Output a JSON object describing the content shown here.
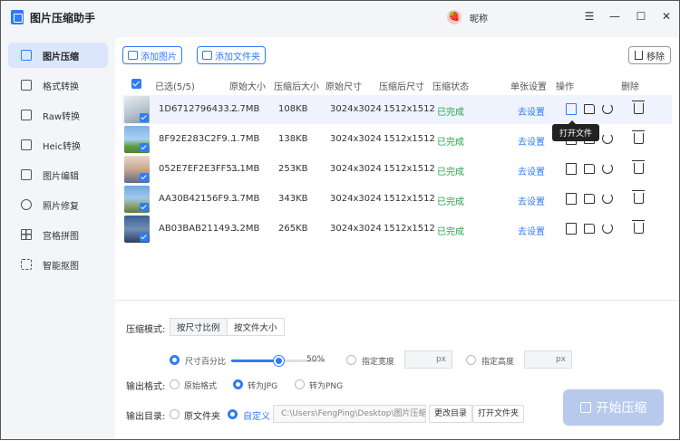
{
  "app": {
    "title": "图片压缩助手",
    "avatar_char": "🍓",
    "nickname": "昵称"
  },
  "window_controls": {
    "menu": "☰",
    "minimize": "—",
    "maximize": "☐",
    "close": "✕"
  },
  "sidebar": {
    "items": [
      {
        "label": "图片压缩",
        "icon": "compress-icon",
        "active": true
      },
      {
        "label": "格式转换",
        "icon": "convert-icon"
      },
      {
        "label": "Raw转换",
        "icon": "raw-icon"
      },
      {
        "label": "Heic转换",
        "icon": "heic-icon"
      },
      {
        "label": "图片编辑",
        "icon": "edit-icon"
      },
      {
        "label": "照片修复",
        "icon": "repair-icon"
      },
      {
        "label": "宫格拼图",
        "icon": "grid-icon"
      },
      {
        "label": "智能抠图",
        "icon": "cutout-icon"
      }
    ]
  },
  "toolbar": {
    "add_image": "添加图片",
    "add_folder": "添加文件夹",
    "remove": "移除"
  },
  "table": {
    "headers": {
      "selected": "已选(5/5)",
      "orig_size": "原始大小",
      "comp_size": "压缩后大小",
      "orig_dim": "原始尺寸",
      "comp_dim": "压缩后尺寸",
      "status": "压缩状态",
      "setting": "单张设置",
      "ops": "操作",
      "delete": "删除"
    },
    "rows": [
      {
        "name": "1D6712796433...",
        "orig_size": "2.7MB",
        "comp_size": "108KB",
        "orig_dim": "3024x3024",
        "comp_dim": "1512x1512",
        "status": "已完成",
        "setting": "去设置"
      },
      {
        "name": "8F92E283C2F9...",
        "orig_size": "1.7MB",
        "comp_size": "138KB",
        "orig_dim": "3024x3024",
        "comp_dim": "1512x1512",
        "status": "已完成",
        "setting": "去设置"
      },
      {
        "name": "052E7EF2E3FF5...",
        "orig_size": "3.1MB",
        "comp_size": "253KB",
        "orig_dim": "3024x3024",
        "comp_dim": "1512x1512",
        "status": "已完成",
        "setting": "去设置"
      },
      {
        "name": "AA30B42156F9...",
        "orig_size": "3.7MB",
        "comp_size": "343KB",
        "orig_dim": "3024x3024",
        "comp_dim": "1512x1512",
        "status": "已完成",
        "setting": "去设置"
      },
      {
        "name": "AB03BAB21149...",
        "orig_size": "3.2MB",
        "comp_size": "265KB",
        "orig_dim": "3024x3024",
        "comp_dim": "1512x1512",
        "status": "已完成",
        "setting": "去设置"
      }
    ]
  },
  "tooltip": "打开文件",
  "settings": {
    "mode_label": "压缩模式:",
    "mode_by_ratio": "按尺寸比例",
    "mode_by_size": "按文件大小",
    "size_percent": "尺寸百分比",
    "percent_value": "50%",
    "percent_fraction": 0.5,
    "width_label": "指定宽度",
    "height_label": "指定高度",
    "px_unit": "px",
    "format_label": "输出格式:",
    "fmt_original": "原始格式",
    "fmt_jpg": "转为JPG",
    "fmt_png": "转为PNG",
    "dir_label": "输出目录:",
    "dir_source": "原文件夹",
    "dir_custom": "自定义",
    "dir_path": "C:\\Users\\FengPing\\Desktop\\图片压缩",
    "change_dir": "更改目录",
    "open_folder": "打开文件夹",
    "start": "开始压缩"
  },
  "colors": {
    "accent": "#2f7bf5",
    "done": "#27a34a",
    "start_disabled": "#b8c9ee",
    "row_highlight": "#eef3fd"
  }
}
